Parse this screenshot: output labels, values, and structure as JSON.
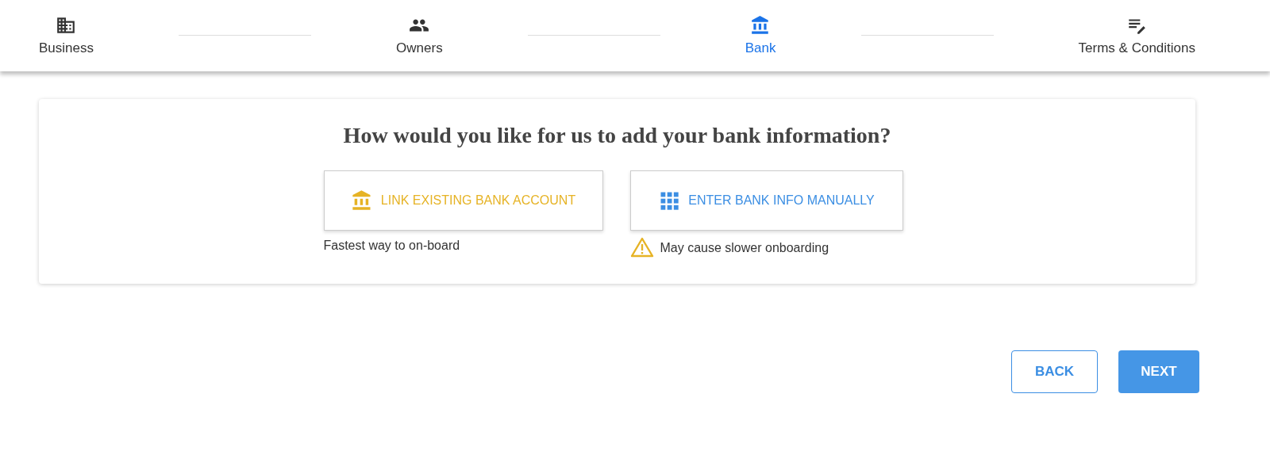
{
  "steps": [
    {
      "label": "Business",
      "kind": "building",
      "selected": false
    },
    {
      "label": "Owners",
      "kind": "people",
      "selected": false
    },
    {
      "label": "Bank",
      "kind": "bank",
      "selected": true
    },
    {
      "label": "Terms & Conditions",
      "kind": "edit-list",
      "selected": false
    }
  ],
  "card": {
    "title": "How would you like for us to add your bank information?",
    "options": [
      {
        "label": "LINK EXISTING BANK ACCOUNT",
        "kind": "bank",
        "color": "#e6b325",
        "note": "Fastest way to on-board",
        "warning": false
      },
      {
        "label": "ENTER BANK INFO MANUALLY",
        "kind": "grid",
        "color": "#3b8ee3",
        "note": "May cause slower onboarding",
        "warning": true
      }
    ]
  },
  "buttons": [
    {
      "label": "BACK",
      "kind": "outline"
    },
    {
      "label": "NEXT",
      "kind": "filled"
    }
  ]
}
